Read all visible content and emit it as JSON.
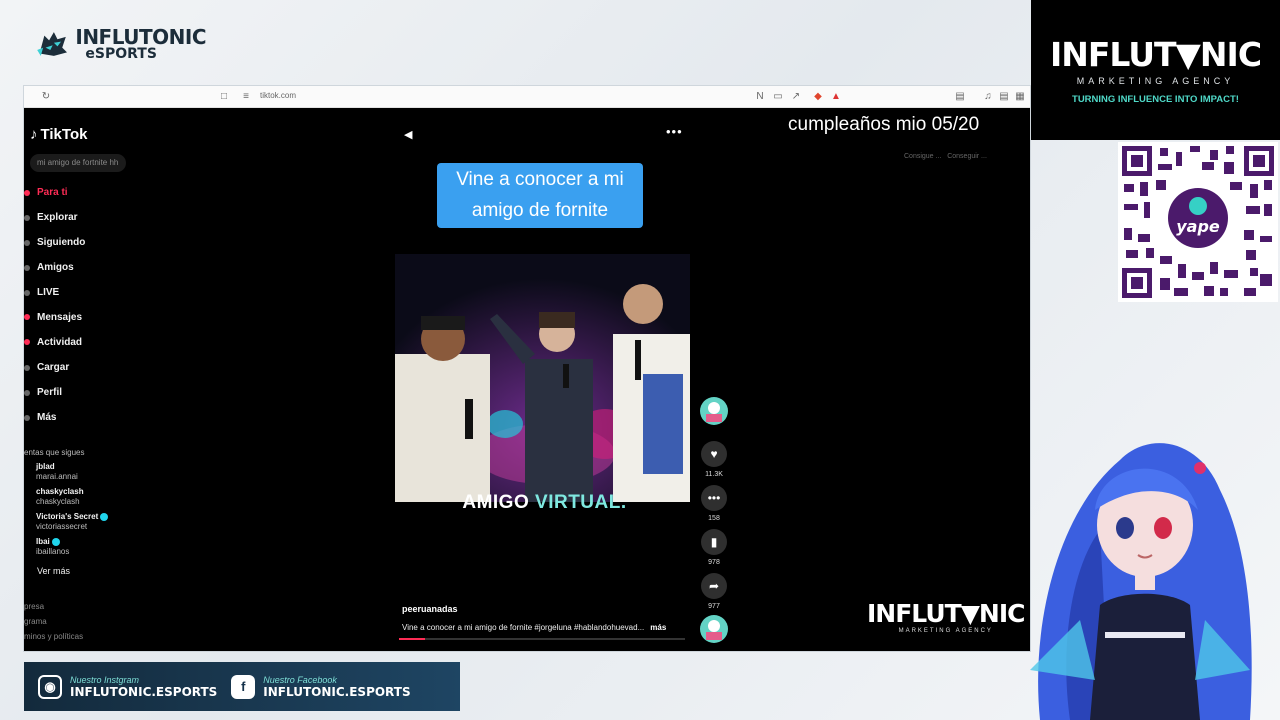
{
  "brand": {
    "top_left_name": "INFLUTONIC",
    "top_left_sub": "eSPORTS",
    "top_right_name": "INFLUT▼NIC",
    "top_right_sub": "MARKETING AGENCY",
    "top_right_tagline": "TURNING INFLUENCE INTO IMPACT!",
    "bottom_right_name": "INFLUT▼NIC",
    "bottom_right_sub": "MARKETING AGENCY",
    "qr_label": "yape"
  },
  "browser": {
    "url": "tiktok.com"
  },
  "tiktok": {
    "logo": "TikTok",
    "search_placeholder": "mi amigo de fortnite hh",
    "nav": [
      {
        "label": "Para ti",
        "active": true
      },
      {
        "label": "Explorar"
      },
      {
        "label": "Siguiendo"
      },
      {
        "label": "Amigos"
      },
      {
        "label": "LIVE"
      },
      {
        "label": "Mensajes"
      },
      {
        "label": "Actividad"
      },
      {
        "label": "Cargar"
      },
      {
        "label": "Perfil"
      },
      {
        "label": "Más"
      }
    ],
    "following_header": "entas que sigues",
    "following": [
      {
        "user": "jblad",
        "handle": "marai.annai"
      },
      {
        "user": "chaskyclash",
        "handle": "chaskyclash"
      },
      {
        "user": "Victoria's Secret",
        "handle": "victoriassecret",
        "verified": true
      },
      {
        "user": "Ibai",
        "handle": "ibaillanos",
        "verified": true
      }
    ],
    "see_more": "Ver más",
    "footer": [
      "presa",
      "grama",
      "minos y políticas"
    ],
    "video": {
      "caption_line1": "Vine a conocer a mi",
      "caption_line2": "amigo de fornite",
      "overlay_word1": "AMIGO",
      "overlay_word2": "VIRTUAL.",
      "username": "peeruanadas",
      "description": "Vine a conocer a mi amigo de fornite #jorgeluna #hablandohuevad...",
      "more_label": "más",
      "progress": 0.09
    },
    "actions": {
      "likes": "11.3K",
      "comments": "158",
      "saves": "978",
      "shares": "977"
    },
    "consigue_labels": [
      "Consigue ...",
      "Conseguir ..."
    ]
  },
  "stream_overlay": {
    "birthday_text": "cumpleaños mio 05/20"
  },
  "socials": {
    "instagram_label": "Nuestro Instgram",
    "instagram_handle": "INFLUTONIC.ESPORTS",
    "facebook_label": "Nuestro Facebook",
    "facebook_handle": "INFLUTONIC.ESPORTS"
  },
  "colors": {
    "tiktok_accent": "#fe2c55",
    "caption_bg": "#3aa0f0",
    "brand_teal": "#4fd9c8"
  }
}
